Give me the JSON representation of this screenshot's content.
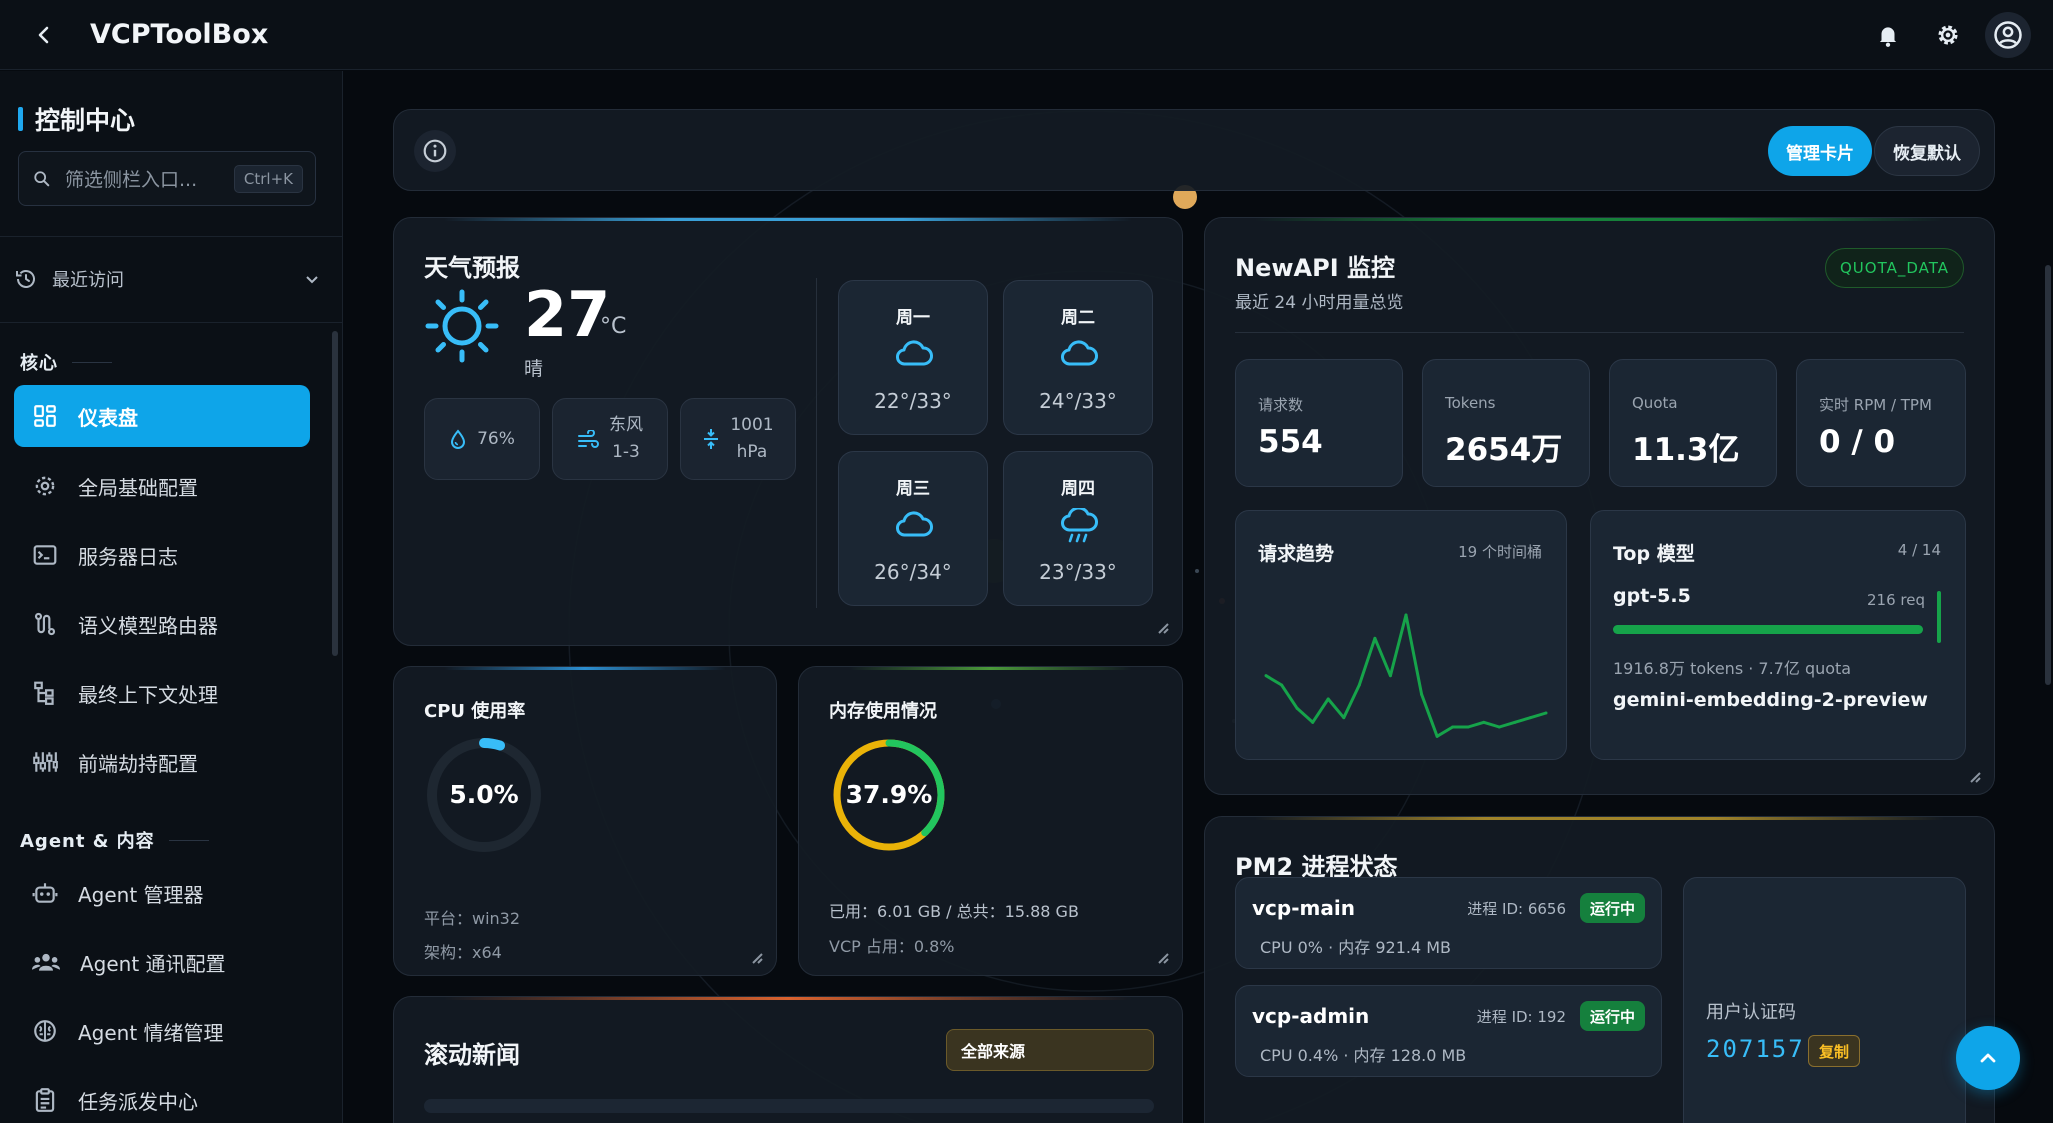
{
  "app": {
    "title": "VCPToolBox"
  },
  "sidebar": {
    "heading": "控制中心",
    "search_placeholder": "筛选侧栏入口...",
    "search_shortcut": "Ctrl+K",
    "recent_label": "最近访问",
    "sections": {
      "core": "核心",
      "agent": "Agent & 内容"
    },
    "items": [
      {
        "label": "仪表盘",
        "active": true
      },
      {
        "label": "全局基础配置"
      },
      {
        "label": "服务器日志"
      },
      {
        "label": "语义模型路由器"
      },
      {
        "label": "最终上下文处理"
      },
      {
        "label": "前端劫持配置"
      },
      {
        "label": "Agent 管理器"
      },
      {
        "label": "Agent 通讯配置"
      },
      {
        "label": "Agent 情绪管理"
      },
      {
        "label": "任务派发中心"
      }
    ]
  },
  "toolbar": {
    "manage_label": "管理卡片",
    "reset_label": "恢复默认"
  },
  "weather": {
    "title": "天气预报",
    "temperature": "27",
    "unit": "°C",
    "condition": "晴",
    "humidity": "76%",
    "wind_dir": "东风",
    "wind_level": "1-3",
    "pressure_value": "1001",
    "pressure_unit": "hPa",
    "forecast": [
      {
        "day": "周一",
        "range": "22°/33°",
        "icon": "cloud-icon"
      },
      {
        "day": "周二",
        "range": "24°/33°",
        "icon": "cloud-icon"
      },
      {
        "day": "周三",
        "range": "26°/34°",
        "icon": "cloud-icon"
      },
      {
        "day": "周四",
        "range": "23°/33°",
        "icon": "rain-cloud-icon"
      }
    ]
  },
  "cpu": {
    "title": "CPU 使用率",
    "value": "5.0%",
    "percent": 5.0,
    "platform": "平台：win32",
    "arch": "架构：x64"
  },
  "memory": {
    "title": "内存使用情况",
    "value": "37.9%",
    "percent": 37.9,
    "used": "已用：6.01 GB / 总共：15.88 GB",
    "vcp": "VCP 占用：0.8%"
  },
  "news": {
    "title": "滚动新闻",
    "source": "全部来源"
  },
  "newapi": {
    "title": "NewAPI 监控",
    "subtitle": "最近 24 小时用量总览",
    "badge": "QUOTA_DATA",
    "stats": [
      {
        "label": "请求数",
        "value": "554"
      },
      {
        "label": "Tokens",
        "value": "2654万"
      },
      {
        "label": "Quota",
        "value": "11.3亿"
      },
      {
        "label": "实时 RPM / TPM",
        "value": "0 / 0"
      }
    ],
    "trend": {
      "title": "请求趋势",
      "buckets": "19 个时间桶"
    },
    "top_models": {
      "title": "Top 模型",
      "page": "4 / 14",
      "items": [
        {
          "name": "gpt-5.5",
          "req": "216 req",
          "detail": "1916.8万 tokens · 7.7亿 quota",
          "share": 1.0
        },
        {
          "name": "gemini-embedding-2-preview"
        }
      ]
    }
  },
  "chart_data": {
    "type": "line",
    "title": "请求趋势",
    "x": [
      1,
      2,
      3,
      4,
      5,
      6,
      7,
      8,
      9,
      10,
      11,
      12,
      13,
      14,
      15,
      16,
      17,
      18,
      19
    ],
    "series": [
      {
        "values": [
          14,
          12,
          7,
          4,
          9,
          5,
          12,
          22,
          14,
          27,
          10,
          1,
          3,
          3,
          4,
          3,
          4,
          5,
          6
        ]
      }
    ],
    "ylim": [
      0,
      30
    ],
    "grid": false
  },
  "pm2": {
    "title": "PM2 进程状态",
    "processes": [
      {
        "name": "vcp-main",
        "pid": "进程 ID: 6656",
        "status": "运行中",
        "usage": "CPU 0% · 内存 921.4 MB"
      },
      {
        "name": "vcp-admin",
        "pid": "进程 ID: 192",
        "status": "运行中",
        "usage": "CPU 0.4% · 内存 128.0 MB"
      }
    ],
    "auth_label": "用户认证码",
    "auth_code": "207157",
    "copy_label": "复制"
  },
  "colors": {
    "accent": "#0ea5e9",
    "success": "#16a34a",
    "warning": "#eab308"
  }
}
